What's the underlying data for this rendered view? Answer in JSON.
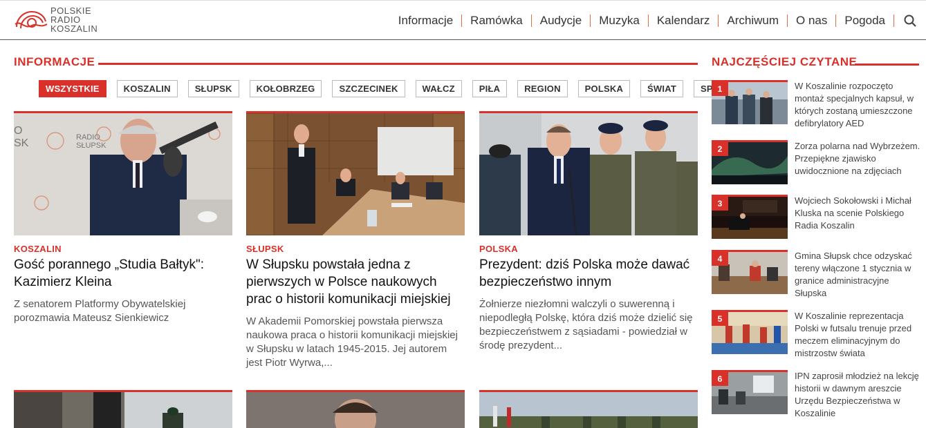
{
  "header": {
    "logo": {
      "line1": "POLSKIE",
      "line2": "RADIO",
      "line3": "KOSZALIN"
    },
    "nav": [
      {
        "label": "Informacje"
      },
      {
        "label": "Ramówka"
      },
      {
        "label": "Audycje"
      },
      {
        "label": "Muzyka"
      },
      {
        "label": "Kalendarz"
      },
      {
        "label": "Archiwum"
      },
      {
        "label": "O nas"
      },
      {
        "label": "Pogoda"
      }
    ],
    "search_icon": "search-icon"
  },
  "main": {
    "section_title": "INFORMACJE",
    "filters": [
      {
        "label": "WSZYSTKIE",
        "active": true
      },
      {
        "label": "KOSZALIN"
      },
      {
        "label": "SŁUPSK"
      },
      {
        "label": "KOŁOBRZEG"
      },
      {
        "label": "SZCZECINEK"
      },
      {
        "label": "WAŁCZ"
      },
      {
        "label": "PIŁA"
      },
      {
        "label": "REGION"
      },
      {
        "label": "POLSKA"
      },
      {
        "label": "ŚWIAT"
      },
      {
        "label": "SPORT"
      }
    ],
    "articles": [
      {
        "category": "KOSZALIN",
        "title": "Gość porannego „Studia Bałtyk\": Kazimierz Kleina",
        "lead": "Z senatorem Platformy Obywatelskiej porozmawia Mateusz Sienkiewicz"
      },
      {
        "category": "SŁUPSK",
        "title": "W Słupsku powstała jedna z pierwszych w Polsce naukowych prac o historii komunikacji miejskiej",
        "lead": "W Akademii Pomorskiej powstała pierwsza naukowa praca o historii komunikacji miejskiej w Słupsku w latach 1945-2015. Jej autorem jest Piotr Wyrwa,..."
      },
      {
        "category": "POLSKA",
        "title": "Prezydent: dziś Polska może dawać bezpieczeństwo innym",
        "lead": "Żołnierze niezłomni walczyli o suwerenną i niepodległą Polskę, która dziś może dzielić się bezpieczeństwem z sąsiadami - powiedział w środę prezydent..."
      }
    ]
  },
  "sidebar": {
    "section_title": "NAJCZĘŚCIEJ CZYTANE",
    "items": [
      {
        "num": "1",
        "text": "W Koszalinie rozpoczęto montaż specjalnych kapsuł, w których zostaną umieszczone defibrylatory AED"
      },
      {
        "num": "2",
        "text": "Zorza polarna nad Wybrzeżem. Przepiękne zjawisko uwidocznione na zdjęciach"
      },
      {
        "num": "3",
        "text": "Wojciech Sokołowski i Michał Kluska na scenie Polskiego Radia Koszalin"
      },
      {
        "num": "4",
        "text": "Gmina Słupsk chce odzyskać tereny włączone 1 stycznia w granice administracyjne Słupska"
      },
      {
        "num": "5",
        "text": "W Koszalinie reprezentacja Polski w futsalu trenuje przed meczem eliminacyjnym do mistrzostw świata"
      },
      {
        "num": "6",
        "text": "IPN zaprosił młodzież na lekcję historii w dawnym areszcie Urzędu Bezpieczeństwa w Koszalinie"
      }
    ]
  },
  "colors": {
    "accent": "#d9302a",
    "nav_separator": "#e36e3a"
  }
}
